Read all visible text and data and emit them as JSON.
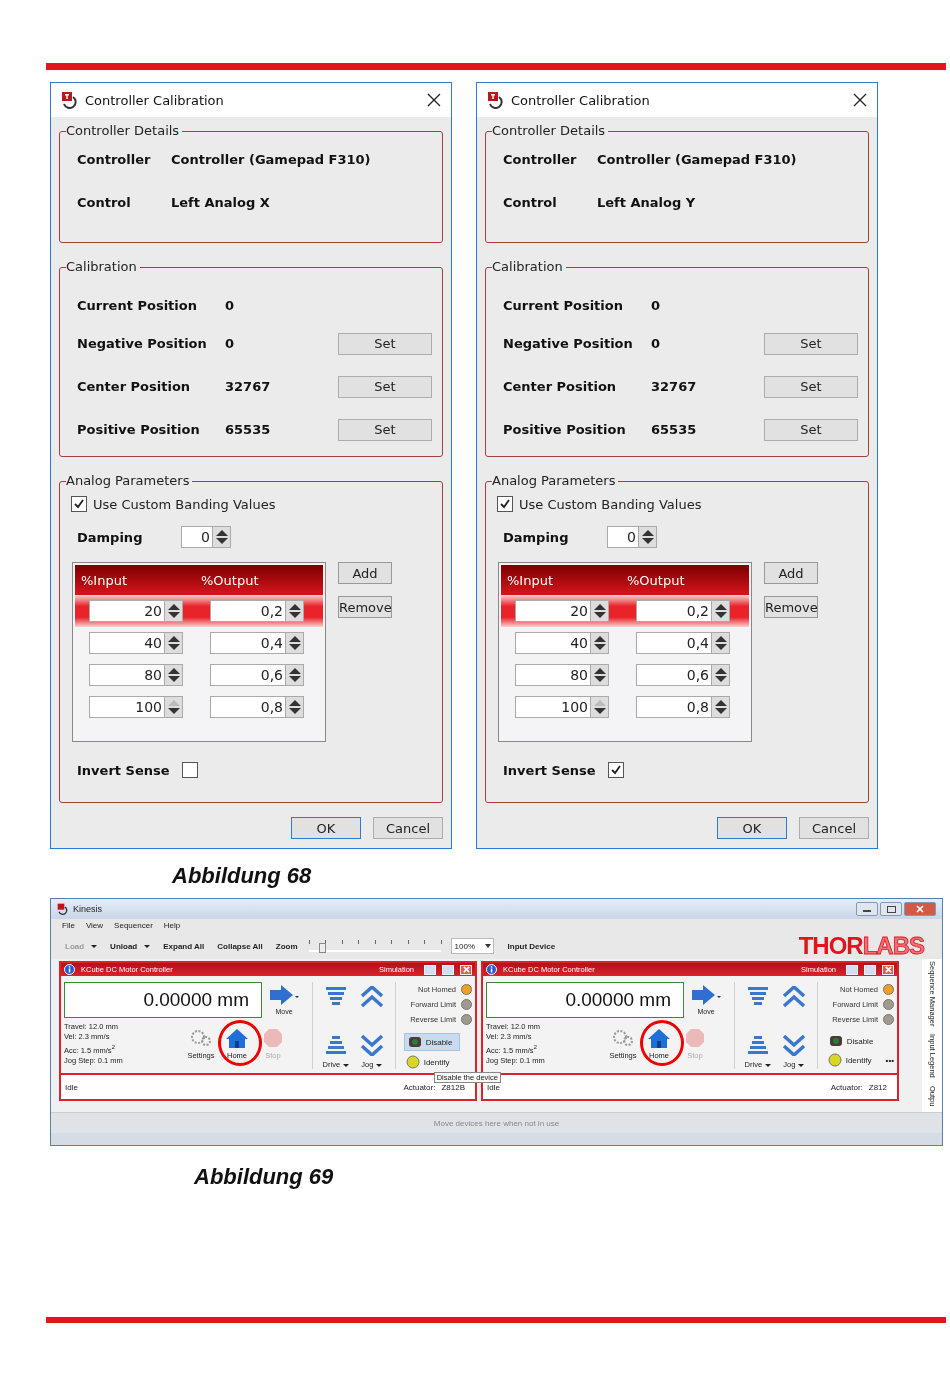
{
  "dialogs": [
    {
      "title": "Controller Calibration",
      "details": {
        "legend": "Controller Details",
        "rows": [
          {
            "label": "Controller",
            "value": "Controller (Gamepad F310)"
          },
          {
            "label": "Control",
            "value": "Left Analog X"
          }
        ]
      },
      "calibration": {
        "legend": "Calibration",
        "rows": [
          {
            "label": "Current Position",
            "value": "0"
          },
          {
            "label": "Negative Position",
            "value": "0",
            "button": "Set"
          },
          {
            "label": "Center Position",
            "value": "32767",
            "button": "Set"
          },
          {
            "label": "Positive Position",
            "value": "65535",
            "button": "Set"
          }
        ]
      },
      "analog": {
        "legend": "Analog Parameters",
        "custom": {
          "label": "Use Custom Banding Values",
          "checked": true
        },
        "damping": {
          "label": "Damping",
          "value": "0"
        },
        "columns": [
          "%Input",
          "%Output"
        ],
        "rows": [
          {
            "input": "20",
            "output": "0,2",
            "selected": true,
            "input_up_disabled": false
          },
          {
            "input": "40",
            "output": "0,4",
            "selected": false,
            "input_up_disabled": false
          },
          {
            "input": "80",
            "output": "0,6",
            "selected": false,
            "input_up_disabled": false
          },
          {
            "input": "100",
            "output": "0,8",
            "selected": false,
            "input_up_disabled": true
          }
        ],
        "add": "Add",
        "remove": "Remove",
        "invert": {
          "label": "Invert Sense",
          "checked": false
        }
      },
      "buttons": [
        "OK",
        "Cancel"
      ]
    },
    {
      "title": "Controller Calibration",
      "details": {
        "legend": "Controller Details",
        "rows": [
          {
            "label": "Controller",
            "value": "Controller (Gamepad F310)"
          },
          {
            "label": "Control",
            "value": "Left Analog Y"
          }
        ]
      },
      "calibration": {
        "legend": "Calibration",
        "rows": [
          {
            "label": "Current Position",
            "value": "0"
          },
          {
            "label": "Negative Position",
            "value": "0",
            "button": "Set"
          },
          {
            "label": "Center Position",
            "value": "32767",
            "button": "Set"
          },
          {
            "label": "Positive Position",
            "value": "65535",
            "button": "Set"
          }
        ]
      },
      "analog": {
        "legend": "Analog Parameters",
        "custom": {
          "label": "Use Custom Banding Values",
          "checked": true
        },
        "damping": {
          "label": "Damping",
          "value": "0"
        },
        "columns": [
          "%Input",
          "%Output"
        ],
        "rows": [
          {
            "input": "20",
            "output": "0,2",
            "selected": true,
            "input_up_disabled": false
          },
          {
            "input": "40",
            "output": "0,4",
            "selected": false,
            "input_up_disabled": false
          },
          {
            "input": "80",
            "output": "0,6",
            "selected": false,
            "input_up_disabled": false
          },
          {
            "input": "100",
            "output": "0,8",
            "selected": false,
            "input_up_disabled": true
          }
        ],
        "add": "Add",
        "remove": "Remove",
        "invert": {
          "label": "Invert Sense",
          "checked": true
        }
      },
      "buttons": [
        "OK",
        "Cancel"
      ]
    }
  ],
  "caption_1": "Abbildung 68",
  "kinesis": {
    "title": "Kinesis",
    "menu": [
      "File",
      "View",
      "Sequencer",
      "Help"
    ],
    "toolbar": [
      {
        "label": "Load",
        "dropdown": true,
        "disabled": true
      },
      {
        "label": "Unload",
        "dropdown": true,
        "disabled": false
      },
      {
        "label": "Expand All",
        "dropdown": false,
        "disabled": false
      },
      {
        "label": "Collapse All",
        "dropdown": false,
        "disabled": false
      }
    ],
    "zoom": {
      "label": "Zoom",
      "level": 0.1,
      "value": "100%"
    },
    "input_device": "Input Device",
    "logo": {
      "solid": "THOR",
      "outline": "LABS"
    },
    "panels": [
      {
        "title": "KCube DC Motor Controller",
        "mode": "Simulation",
        "position": "0.00000 mm",
        "move": "Move",
        "info": [
          "Travel: 12.0 mm",
          "Vel: 2.3 mm/s",
          "Acc: 1.5 mm/s$^{2}$",
          "Jog Step: 0.1 mm"
        ],
        "buttons": [
          {
            "label": "Settings",
            "kind": "settings",
            "disabled": false,
            "circled": false
          },
          {
            "label": "Home",
            "kind": "home",
            "disabled": false,
            "circled": true
          },
          {
            "label": "Stop",
            "kind": "stop",
            "disabled": true,
            "circled": false
          }
        ],
        "drive": "Drive",
        "jog": "Jog",
        "status": [
          {
            "label": "Not Homed",
            "color": "#f0a020"
          },
          {
            "label": "Forward Limit",
            "color": "#a09a90"
          },
          {
            "label": "Reverse Limit",
            "color": "#a09a90"
          }
        ],
        "disable": {
          "label": "Disable",
          "highlighted": true
        },
        "identify": "Identify",
        "tooltip": "Disable the device",
        "state": "Idle",
        "actuator_label": "Actuator:",
        "actuator": "Z812B"
      },
      {
        "title": "KCube DC Motor Controller",
        "mode": "Simulation",
        "position": "0.00000 mm",
        "move": "Move",
        "info": [
          "Travel: 12.0 mm",
          "Vel: 2.3 mm/s",
          "Acc: 1.5 mm/s$^{2}$",
          "Jog Step: 0.1 mm"
        ],
        "buttons": [
          {
            "label": "Settings",
            "kind": "settings",
            "disabled": false,
            "circled": false
          },
          {
            "label": "Home",
            "kind": "home",
            "disabled": false,
            "circled": true
          },
          {
            "label": "Stop",
            "kind": "stop",
            "disabled": true,
            "circled": false
          }
        ],
        "drive": "Drive",
        "jog": "Jog",
        "status": [
          {
            "label": "Not Homed",
            "color": "#f0a020"
          },
          {
            "label": "Forward Limit",
            "color": "#a09a90"
          },
          {
            "label": "Reverse Limit",
            "color": "#a09a90"
          }
        ],
        "disable": {
          "label": "Disable",
          "highlighted": false
        },
        "identify": "Identify",
        "more": "•••",
        "state": "Idle",
        "actuator_label": "Actuator:",
        "actuator": "Z812"
      }
    ],
    "side_tabs": [
      "Sequence Manager",
      "Input Legend",
      "Outpu"
    ],
    "footer": "Move devices here when not in use"
  },
  "caption_2": "Abbildung 69"
}
